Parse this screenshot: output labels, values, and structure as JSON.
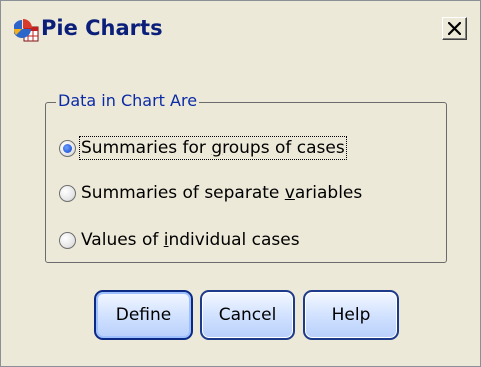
{
  "window": {
    "title": "Pie Charts",
    "icon": "chart-app-icon",
    "close_icon": "close-x-icon"
  },
  "group": {
    "legend": "Data in Chart Are",
    "options": [
      {
        "label_pre": "Summaries for ",
        "label_key": "g",
        "label_post": "roups of cases",
        "selected": true
      },
      {
        "label_pre": "Summaries of separate ",
        "label_key": "v",
        "label_post": "ariables",
        "selected": false
      },
      {
        "label_pre": "Values of ",
        "label_key": "i",
        "label_post": "ndividual cases",
        "selected": false
      }
    ]
  },
  "buttons": {
    "define": "Define",
    "cancel": "Cancel",
    "help": "Help"
  },
  "colors": {
    "title_text": "#0b1f7a",
    "legend_text": "#0b2aa6",
    "dialog_bg": "#ece9d8",
    "button_border": "#1e3a8a"
  }
}
